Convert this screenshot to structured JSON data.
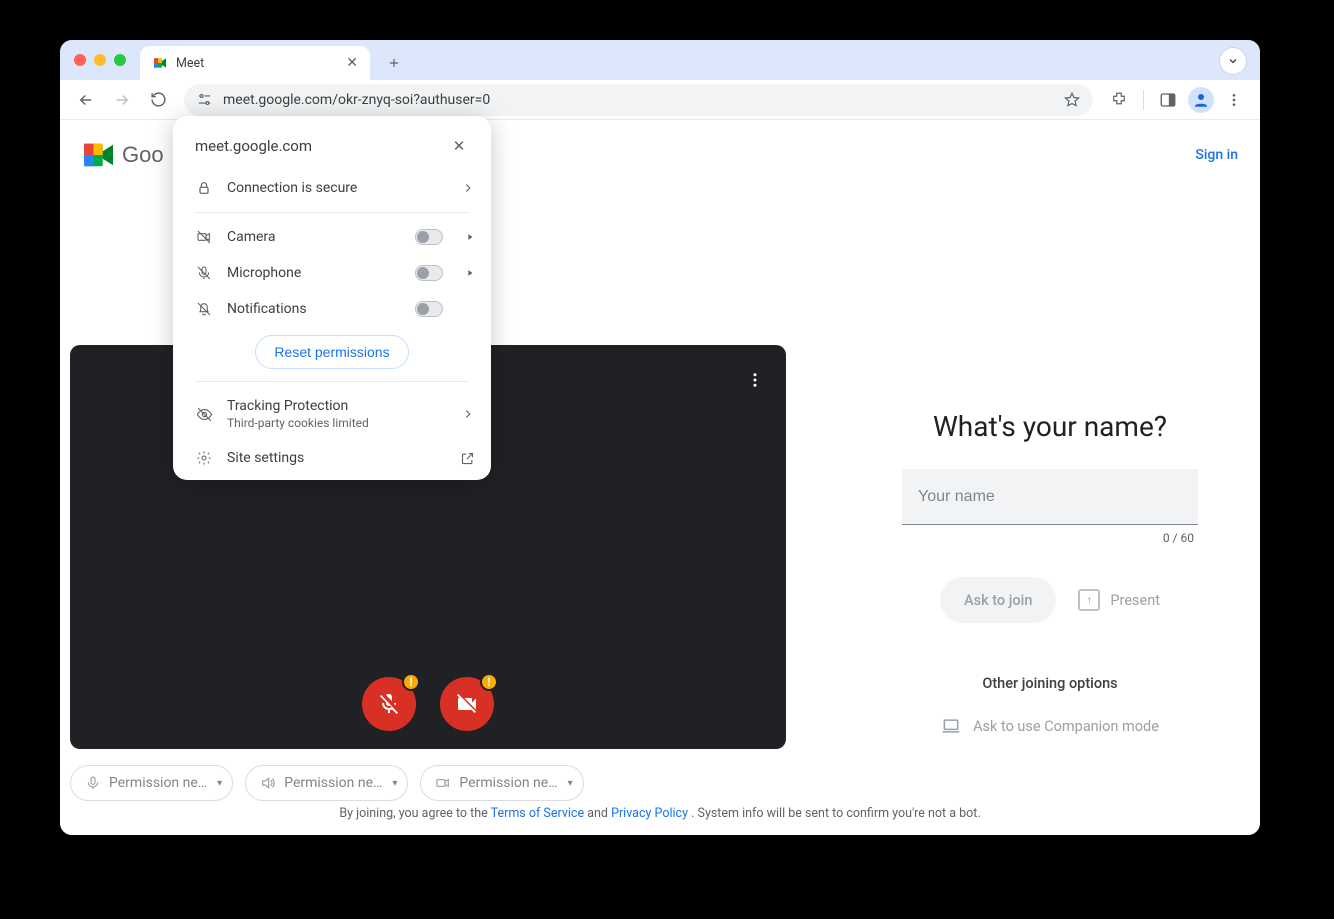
{
  "browser": {
    "tab_title": "Meet",
    "url": "meet.google.com/okr-znyq-soi?authuser=0"
  },
  "site_popup": {
    "host": "meet.google.com",
    "connection": "Connection is secure",
    "perm_camera": "Camera",
    "perm_microphone": "Microphone",
    "perm_notifications": "Notifications",
    "reset": "Reset permissions",
    "tracking_title": "Tracking Protection",
    "tracking_sub": "Third-party cookies limited",
    "site_settings": "Site settings"
  },
  "header": {
    "brand_partial": "Goo",
    "signin": "Sign in"
  },
  "chips": {
    "mic": "Permission ne…",
    "speaker": "Permission ne…",
    "camera": "Permission ne…"
  },
  "right": {
    "question": "What's your name?",
    "placeholder": "Your name",
    "value": "",
    "counter": "0 / 60",
    "ask_join": "Ask to join",
    "present": "Present",
    "other_options": "Other joining options",
    "companion": "Ask to use Companion mode"
  },
  "footer": {
    "prefix": "By joining, you agree to the ",
    "tos": "Terms of Service",
    "and": " and ",
    "privacy": "Privacy Policy",
    "suffix": ". System info will be sent to confirm you're not a bot."
  }
}
